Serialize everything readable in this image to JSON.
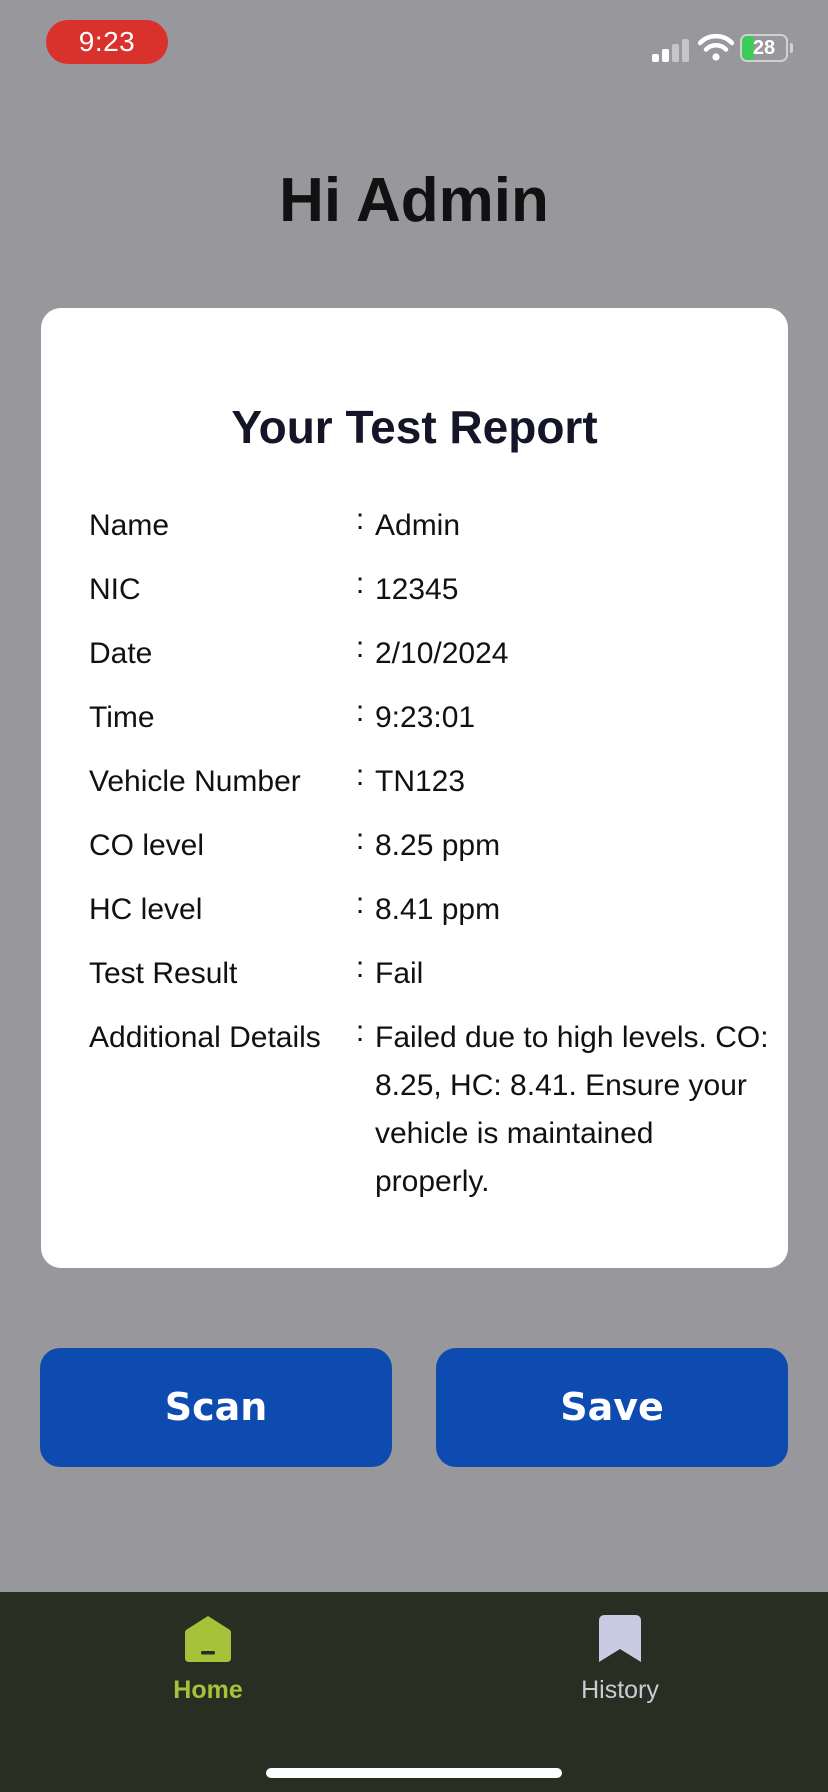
{
  "status_bar": {
    "time": "9:23",
    "battery": "28",
    "battery_level": 0.28,
    "icons": [
      "signal-icon",
      "wifi-icon",
      "battery-icon"
    ]
  },
  "greeting": "Hi Admin",
  "report": {
    "title": "Your Test Report",
    "separator": ":",
    "rows": [
      {
        "label": "Name",
        "value": "Admin"
      },
      {
        "label": "NIC",
        "value": "12345"
      },
      {
        "label": "Date",
        "value": "2/10/2024"
      },
      {
        "label": "Time",
        "value": "9:23:01"
      },
      {
        "label": "Vehicle Number",
        "value": "TN123"
      },
      {
        "label": "CO level",
        "value": "8.25 ppm"
      },
      {
        "label": "HC level",
        "value": "8.41 ppm"
      },
      {
        "label": "Test Result",
        "value": "Fail"
      },
      {
        "label": "Additional Details",
        "value": "Failed due to high levels. CO: 8.25, HC: 8.41. Ensure your vehicle is maintained properly."
      }
    ]
  },
  "actions": {
    "scan_label": "Scan",
    "save_label": "Save"
  },
  "tab_bar": {
    "tabs": [
      {
        "label": "Home",
        "icon": "home-icon",
        "active": true
      },
      {
        "label": "History",
        "icon": "bookmark-icon",
        "active": false
      }
    ]
  },
  "colors": {
    "background": "#98979c",
    "card": "#ffffff",
    "button": "#0d4bb0",
    "tab_bar": "#292e22",
    "active_tab": "#a6c23a",
    "time_pill": "#d9312b"
  }
}
